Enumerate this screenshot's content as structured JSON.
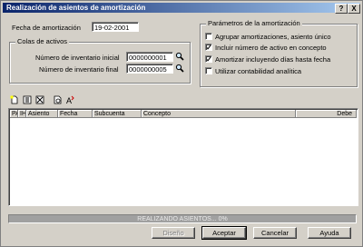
{
  "window": {
    "title": "Realización de asientos de amortización",
    "help_label": "?",
    "close_label": "X"
  },
  "form": {
    "fecha_label": "Fecha de amortización",
    "fecha_value": "19-02-2001"
  },
  "colas": {
    "title": "Colas de activos",
    "inicial_label": "Número de inventario inicial",
    "inicial_value": "0000000001",
    "final_label": "Número de inventario final",
    "final_value": "0000000005"
  },
  "params": {
    "title": "Parámetros de la amortización",
    "options": [
      {
        "label": "Agrupar amortizaciones, asiento único",
        "checked": false
      },
      {
        "label": "Incluir número de activo en concepto",
        "checked": true
      },
      {
        "label": "Amortizar incluyendo días hasta fecha",
        "checked": true
      },
      {
        "label": "Utilizar contabilidad analítica",
        "checked": false
      }
    ]
  },
  "toolbar": {
    "icons": [
      "new-document-icon",
      "properties-icon",
      "delete-icon",
      "preview-icon",
      "sort-icon"
    ]
  },
  "grid": {
    "columns": [
      "PA",
      "IH",
      "Asiento",
      "Fecha",
      "Subcuenta",
      "Concepto",
      "Debe"
    ]
  },
  "status": {
    "text": "REALIZANDO ASIENTOS... 0%"
  },
  "buttons": {
    "diseno": "Diseño",
    "aceptar": "Aceptar",
    "cancelar": "Cancelar",
    "ayuda": "Ayuda"
  },
  "colors": {
    "title_start": "#0a246a",
    "title_end": "#a6caf0",
    "face": "#d4d0c8"
  }
}
